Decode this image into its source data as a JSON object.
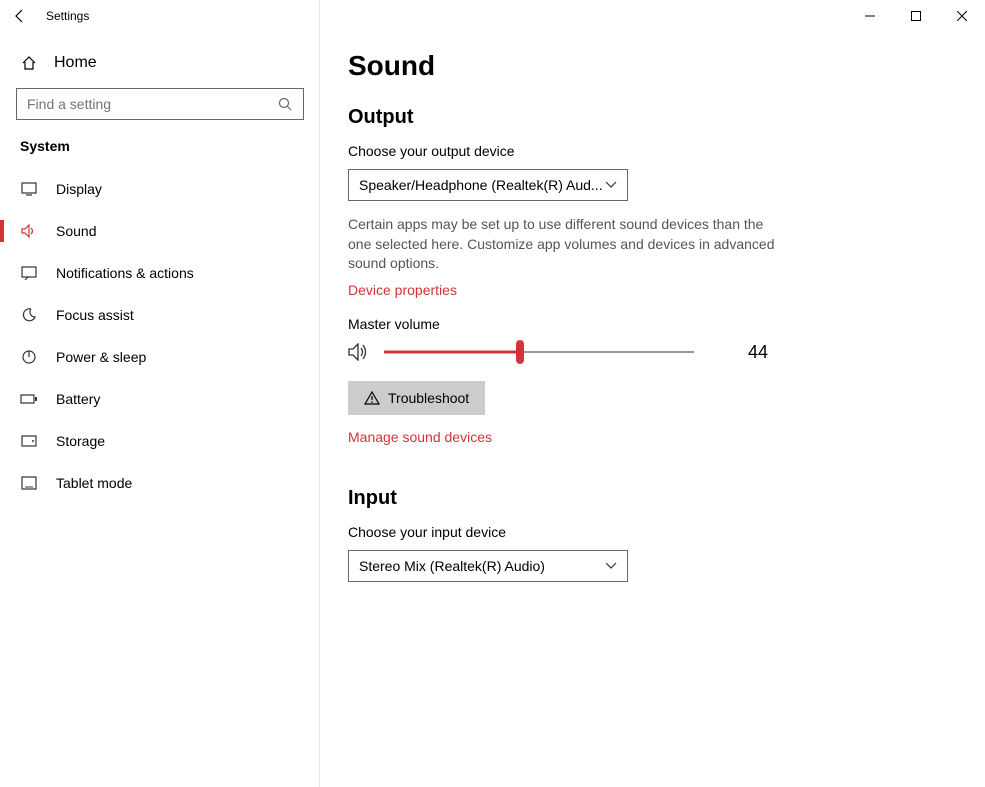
{
  "window": {
    "title": "Settings"
  },
  "sidebar": {
    "home": "Home",
    "search_placeholder": "Find a setting",
    "section": "System",
    "items": [
      {
        "label": "Display"
      },
      {
        "label": "Sound"
      },
      {
        "label": "Notifications & actions"
      },
      {
        "label": "Focus assist"
      },
      {
        "label": "Power & sleep"
      },
      {
        "label": "Battery"
      },
      {
        "label": "Storage"
      },
      {
        "label": "Tablet mode"
      }
    ]
  },
  "content": {
    "title": "Sound",
    "output": {
      "heading": "Output",
      "choose_label": "Choose your output device",
      "device": "Speaker/Headphone (Realtek(R) Aud...",
      "desc": "Certain apps may be set up to use different sound devices than the one selected here. Customize app volumes and devices in advanced sound options.",
      "props_link": "Device properties",
      "master_label": "Master volume",
      "volume": 44,
      "troubleshoot": "Troubleshoot",
      "manage_link": "Manage sound devices"
    },
    "input": {
      "heading": "Input",
      "choose_label": "Choose your input device",
      "device": "Stereo Mix (Realtek(R) Audio)"
    }
  }
}
